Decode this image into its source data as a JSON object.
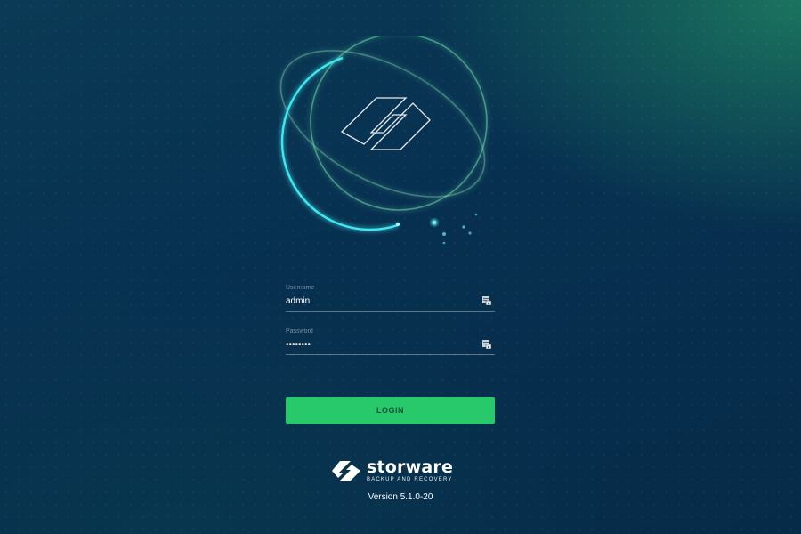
{
  "login_form": {
    "username": {
      "label": "Username",
      "value": "admin"
    },
    "password": {
      "label": "Password",
      "value": "••••••••"
    },
    "login_label": "LOGIN"
  },
  "brand": {
    "name": "storware",
    "tagline": "BACKUP AND RECOVERY"
  },
  "version": "Version 5.1.0-20",
  "colors": {
    "background": "#073050",
    "accent_green": "#27c96a",
    "glow_cyan": "#2fd8e0",
    "orbit_green": "#5ad0a0"
  },
  "icons": {
    "emblem": "storware-s-logo-icon",
    "field_key": "password-manager-key-icon"
  }
}
